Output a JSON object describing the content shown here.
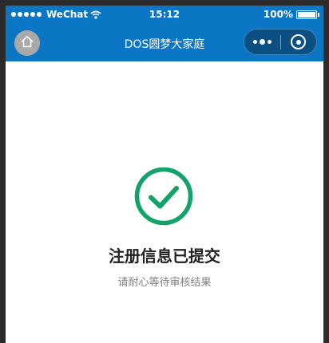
{
  "status_bar": {
    "carrier": "WeChat",
    "time": "15:12",
    "battery": "100%",
    "signal_icon": "signal-dots-icon",
    "wifi_icon": "wifi-icon",
    "battery_icon": "battery-icon",
    "battery_level": 1.0
  },
  "nav_bar": {
    "title": "DOS圆梦大家庭",
    "home_icon": "home-icon",
    "more_icon": "more-dots-icon",
    "close_icon": "mini-program-close-icon",
    "bg_color": "#0b76c4"
  },
  "result": {
    "icon": "check-circle-icon",
    "icon_color": "#12a36a",
    "title": "注册信息已提交",
    "subtitle": "请耐心等待审核结果"
  }
}
